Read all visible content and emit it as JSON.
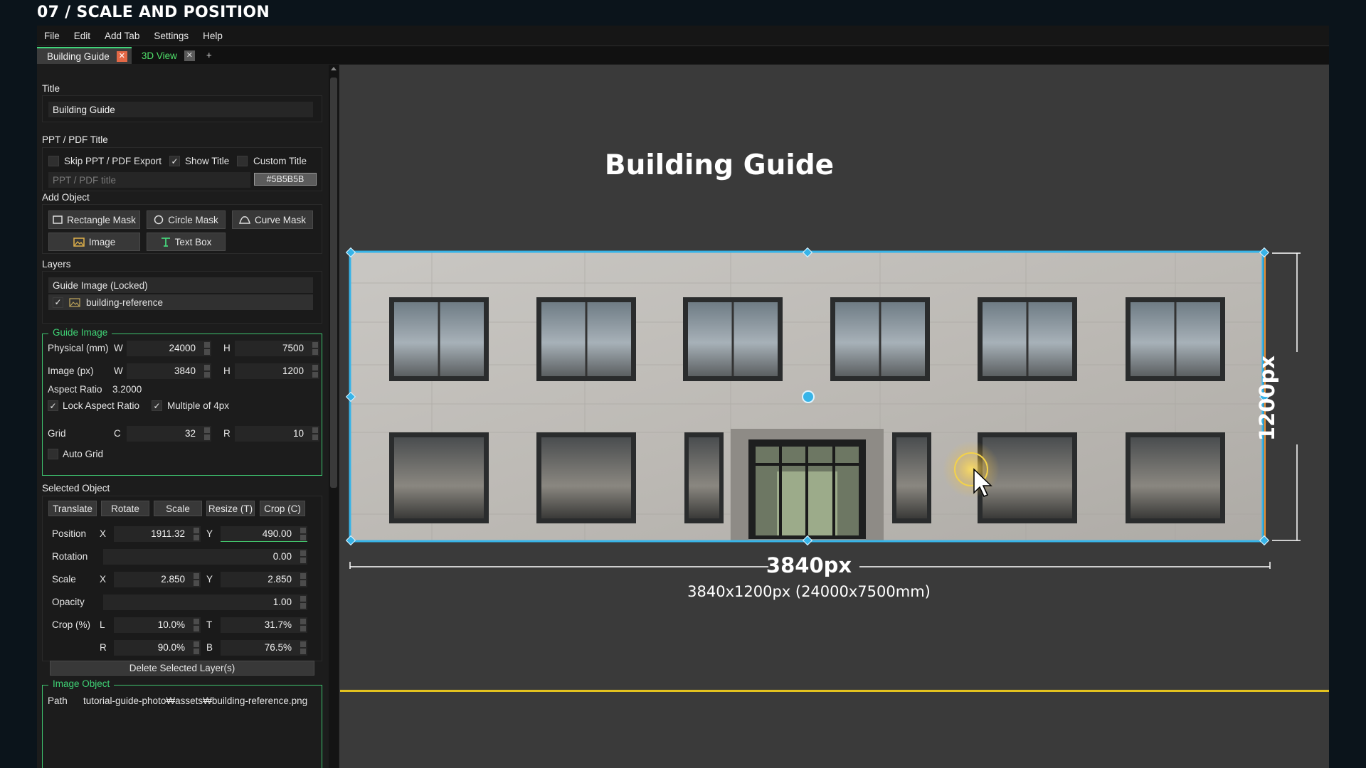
{
  "page_heading": "07 / SCALE AND POSITION",
  "menu": [
    "File",
    "Edit",
    "Add Tab",
    "Settings",
    "Help"
  ],
  "tabs": [
    {
      "label": "Building Guide",
      "close": "✕",
      "active": true
    },
    {
      "label": "3D View",
      "close": "✕",
      "active": false
    }
  ],
  "tab_add": "+",
  "sidebar": {
    "title_section": {
      "label": "Title",
      "value": "Building Guide"
    },
    "ppt_section": {
      "label": "PPT / PDF Title",
      "skip_export": {
        "label": "Skip PPT / PDF Export",
        "checked": false
      },
      "show_title": {
        "label": "Show Title",
        "checked": true
      },
      "custom_title": {
        "label": "Custom Title",
        "checked": false
      },
      "title_placeholder": "PPT / PDF title",
      "color_hex": "#5B5B5B"
    },
    "add_object": {
      "label": "Add Object",
      "rect_mask": "Rectangle Mask",
      "circle_mask": "Circle Mask",
      "curve_mask": "Curve Mask",
      "image": "Image",
      "text_box": "Text Box"
    },
    "layers": {
      "label": "Layers",
      "group": "Guide Image (Locked)",
      "item": {
        "label": "building-reference",
        "checked": true
      }
    },
    "guide_image": {
      "label": "Guide Image",
      "physical_label": "Physical (mm)",
      "image_label": "Image (px)",
      "w": "W",
      "h": "H",
      "physical_w": "24000",
      "physical_h": "7500",
      "image_w": "3840",
      "image_h": "1200",
      "aspect_label": "Aspect Ratio",
      "aspect_value": "3.2000",
      "lock_aspect": {
        "label": "Lock Aspect Ratio",
        "checked": true
      },
      "multiple4": {
        "label": "Multiple of 4px",
        "checked": true
      },
      "grid_label": "Grid",
      "grid_c": "C",
      "grid_r": "R",
      "grid_c_value": "32",
      "grid_r_value": "10",
      "auto_grid": {
        "label": "Auto Grid",
        "checked": false
      }
    },
    "selected_object": {
      "label": "Selected Object",
      "buttons": [
        "Translate",
        "Rotate",
        "Scale",
        "Resize (T)",
        "Crop (C)"
      ],
      "position_label": "Position",
      "x": "X",
      "y": "Y",
      "pos_x": "1911.32",
      "pos_y": "490.00",
      "rotation_label": "Rotation",
      "rotation": "0.00",
      "scale_label": "Scale",
      "scale_x": "2.850",
      "scale_y": "2.850",
      "opacity_label": "Opacity",
      "opacity": "1.00",
      "crop_label": "Crop (%)",
      "l": "L",
      "t": "T",
      "r": "R",
      "b": "B",
      "crop_l": "10.0%",
      "crop_t": "31.7%",
      "crop_r": "90.0%",
      "crop_b": "76.5%",
      "delete_label": "Delete Selected Layer(s)"
    },
    "image_object": {
      "label": "Image Object",
      "path_label": "Path",
      "path_value": "tutorial-guide-photo₩assets₩building-reference.png"
    }
  },
  "canvas": {
    "title": "Building Guide",
    "width_label": "3840px",
    "height_label": "1200px",
    "dims_label": "3840x1200px (24000x7500mm)"
  },
  "colors": {
    "accent_green": "#3fd275",
    "handle_blue": "#37b4e8",
    "yellow_guide": "#e3c21f",
    "close_orange": "#e36846"
  }
}
